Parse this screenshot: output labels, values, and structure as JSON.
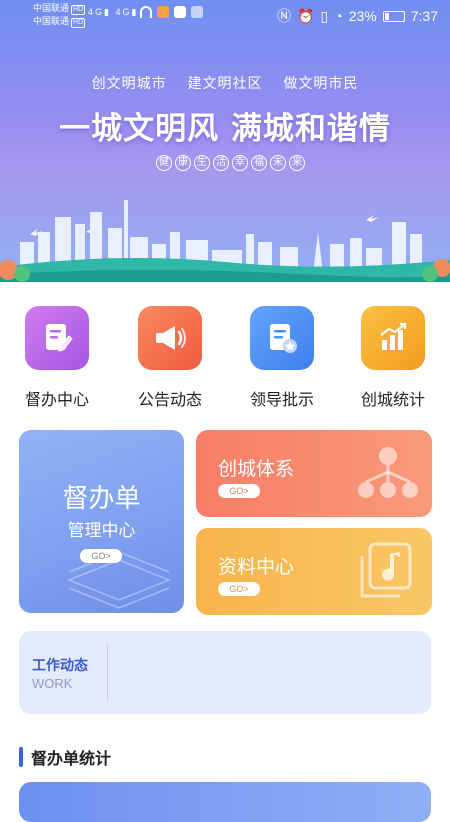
{
  "status_bar": {
    "carrier1": "中国联通",
    "carrier2": "中国联通",
    "hd": "HD",
    "network": "4G",
    "battery_pct": "23%",
    "battery_level": 0.23,
    "time": "7:37",
    "icons": [
      "nfc-icon",
      "alarm-icon",
      "vibrate-icon",
      "speed-icon",
      "battery-icon",
      "wifi-icon",
      "signal-icon"
    ]
  },
  "banner": {
    "top_slogans": [
      "创文明城市",
      "建文明社区",
      "做文明市民"
    ],
    "main_slogan": "一城文明风 满城和谐情",
    "sub_chars": [
      "健",
      "康",
      "生",
      "活",
      "幸",
      "福",
      "未",
      "来"
    ]
  },
  "quick_nav": [
    {
      "label": "督办中心",
      "icon": "supervise-doc-icon",
      "color": "#b86de6"
    },
    {
      "label": "公告动态",
      "icon": "megaphone-icon",
      "color": "#f36a4a"
    },
    {
      "label": "领导批示",
      "icon": "instruction-doc-icon",
      "color": "#4d8ff2"
    },
    {
      "label": "创城统计",
      "icon": "stats-chart-icon",
      "color": "#f7a92a"
    }
  ],
  "cards": {
    "left": {
      "title": "督办单",
      "subtitle": "管理中心",
      "go": "GO>"
    },
    "right_top": {
      "title": "创城体系",
      "go": "GO>"
    },
    "right_bottom": {
      "title": "资料中心",
      "go": "GO>"
    }
  },
  "work": {
    "title": "工作动态",
    "subtitle": "WORK"
  },
  "section": {
    "title": "督办单统计"
  }
}
